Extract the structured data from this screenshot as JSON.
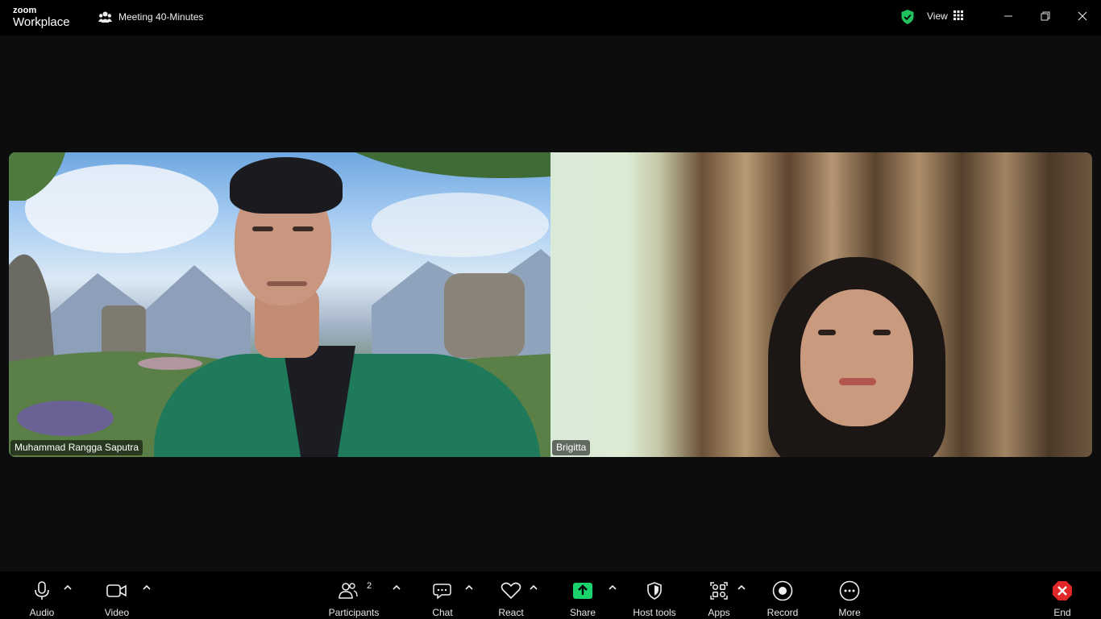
{
  "app": {
    "brand_top": "zoom",
    "brand_bottom": "Workplace"
  },
  "meeting": {
    "title": "Meeting 40-Minutes"
  },
  "header": {
    "view_label": "View"
  },
  "participants_tiles": [
    {
      "name": "Muhammad Rangga Saputra"
    },
    {
      "name": "Brigitta"
    }
  ],
  "toolbar": {
    "audio": "Audio",
    "video": "Video",
    "participants": "Participants",
    "participants_count": "2",
    "chat": "Chat",
    "react": "React",
    "share": "Share",
    "host_tools": "Host tools",
    "apps": "Apps",
    "record": "Record",
    "more": "More",
    "end": "End"
  },
  "colors": {
    "share_accent": "#1ad36d",
    "end_accent": "#e02828",
    "secure_shield": "#21c25e"
  }
}
